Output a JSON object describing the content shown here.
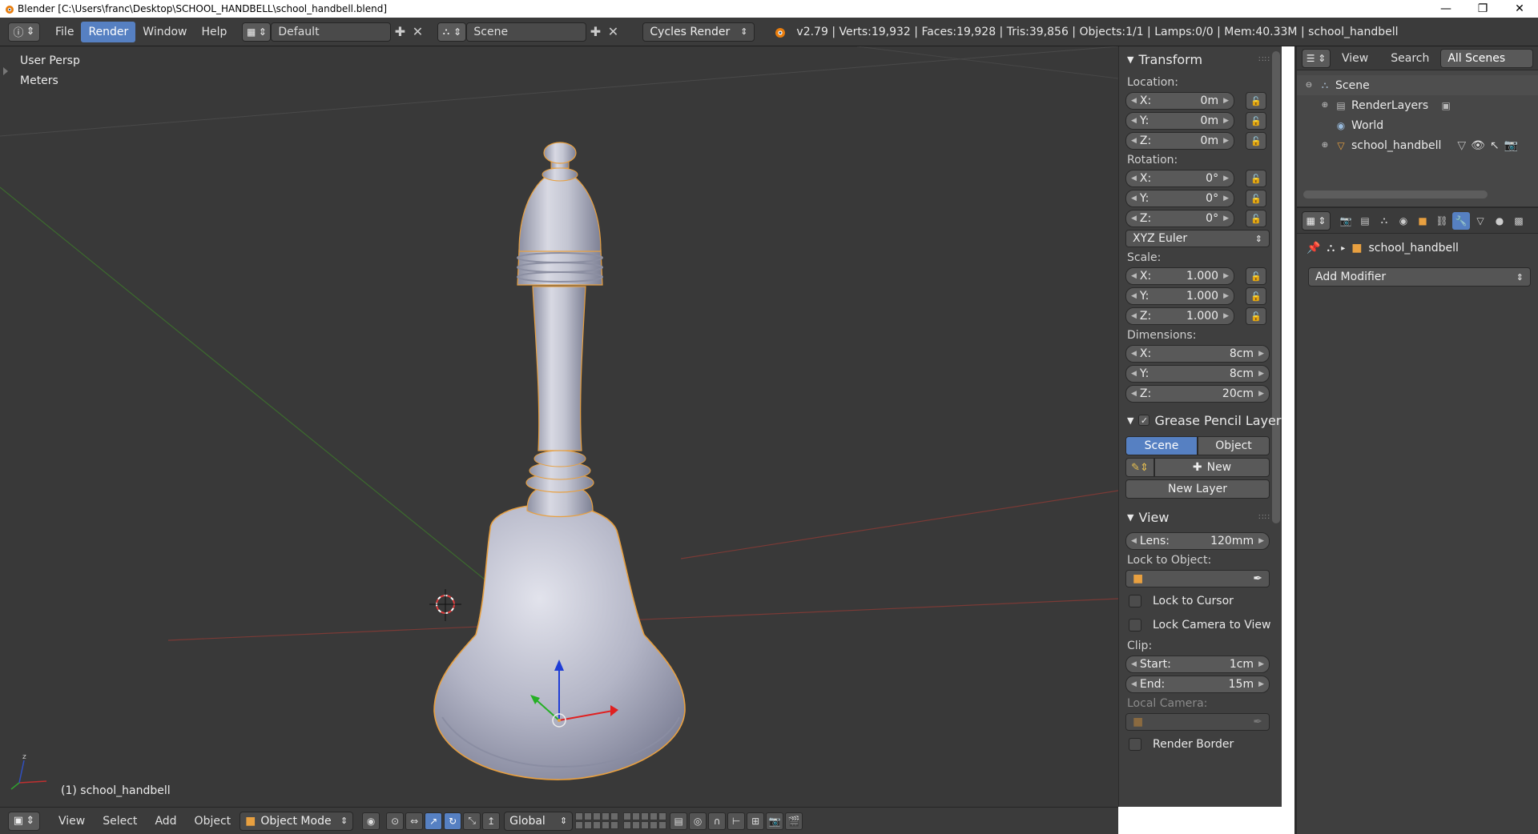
{
  "window": {
    "title": "Blender [C:\\Users\\franc\\Desktop\\SCHOOL_HANDBELL\\school_handbell.blend]",
    "buttons": [
      "—",
      "❐",
      "✕"
    ]
  },
  "infobar": {
    "menus": [
      "File",
      "Render",
      "Window",
      "Help"
    ],
    "active_menu": "Render",
    "layout": "Default",
    "scene": "Scene",
    "render_engine": "Cycles Render",
    "stats": "v2.79 | Verts:19,932 | Faces:19,928 | Tris:39,856 | Objects:1/1 | Lamps:0/0 | Mem:40.33M | school_handbell"
  },
  "viewport": {
    "view_name": "User Persp",
    "units": "Meters",
    "object_label": "(1) school_handbell"
  },
  "footer": {
    "menus": [
      "View",
      "Select",
      "Add",
      "Object"
    ],
    "mode": "Object Mode",
    "orientation": "Global"
  },
  "npanel": {
    "transform": {
      "header": "Transform",
      "location_label": "Location:",
      "location": [
        {
          "axis": "X:",
          "value": "0m"
        },
        {
          "axis": "Y:",
          "value": "0m"
        },
        {
          "axis": "Z:",
          "value": "0m"
        }
      ],
      "rotation_label": "Rotation:",
      "rotation": [
        {
          "axis": "X:",
          "value": "0°"
        },
        {
          "axis": "Y:",
          "value": "0°"
        },
        {
          "axis": "Z:",
          "value": "0°"
        }
      ],
      "rotation_mode": "XYZ Euler",
      "scale_label": "Scale:",
      "scale": [
        {
          "axis": "X:",
          "value": "1.000"
        },
        {
          "axis": "Y:",
          "value": "1.000"
        },
        {
          "axis": "Z:",
          "value": "1.000"
        }
      ],
      "dimensions_label": "Dimensions:",
      "dimensions": [
        {
          "axis": "X:",
          "value": "8cm"
        },
        {
          "axis": "Y:",
          "value": "8cm"
        },
        {
          "axis": "Z:",
          "value": "20cm"
        }
      ]
    },
    "grease_pencil": {
      "header": "Grease Pencil Layer",
      "scene_btn": "Scene",
      "object_btn": "Object",
      "new_btn": "New",
      "new_layer_btn": "New Layer"
    },
    "view": {
      "header": "View",
      "lens_label": "Lens:",
      "lens_value": "120mm",
      "lock_to_object": "Lock to Object:",
      "lock_to_cursor": "Lock to Cursor",
      "lock_camera": "Lock Camera to View",
      "clip_label": "Clip:",
      "clip_start_label": "Start:",
      "clip_start": "1cm",
      "clip_end_label": "End:",
      "clip_end": "15m",
      "local_camera": "Local Camera:",
      "render_border": "Render Border"
    }
  },
  "outliner": {
    "tabs": [
      "View",
      "Search"
    ],
    "filter": "All Scenes",
    "items": [
      {
        "label": "Scene"
      },
      {
        "label": "RenderLayers"
      },
      {
        "label": "World"
      },
      {
        "label": "school_handbell"
      }
    ]
  },
  "properties": {
    "breadcrumb_object": "school_handbell",
    "add_modifier": "Add Modifier"
  },
  "colors": {
    "accent": "#5680c2",
    "viewport_bg": "#393939",
    "selection_outline": "#e8a040"
  }
}
